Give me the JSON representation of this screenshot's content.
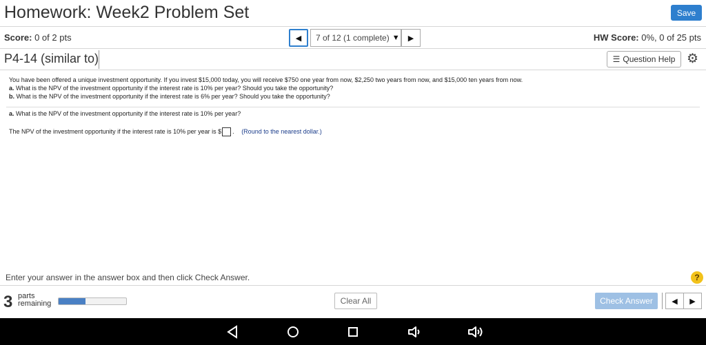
{
  "header": {
    "title": "Homework: Week2 Problem Set",
    "save_label": "Save"
  },
  "score_bar": {
    "score_label": "Score:",
    "score_value": "0 of 2 pts",
    "question_selector": "7 of 12 (1 complete)",
    "hw_score_label": "HW Score:",
    "hw_score_value": "0%, 0 of 25 pts"
  },
  "problem": {
    "id": "P4-14 (similar to)",
    "help_label": "Question Help"
  },
  "question": {
    "intro": "You have been offered a unique investment opportunity. If you invest $15,000 today, you will receive $750 one year from now, $2,250 two years from now, and $15,000 ten years from now.",
    "part_a_label": "a.",
    "part_a_text": "What is the NPV of the  investment opportunity if the interest rate is 10% per year?  Should you take the opportunity?",
    "part_b_label": "b.",
    "part_b_text": "What is the NPV of the  investment opportunity if the interest rate is 6% per year?  Should you take the opportunity?",
    "current_label": "a.",
    "current_text": "What is the NPV of the investment opportunity  if the interest rate is 10% per year?",
    "answer_prompt": "The NPV of the  investment opportunity  if the interest rate is 10% per year is $",
    "answer_suffix": ".",
    "answer_value": "",
    "hint": "(Round to the nearest dollar.)"
  },
  "footer": {
    "instruction": "Enter your answer in the answer box and then click Check Answer.",
    "help_symbol": "?",
    "parts_count": "3",
    "parts_label_1": "parts",
    "parts_label_2": "remaining",
    "progress_fraction": 0.4,
    "clear_all_label": "Clear All",
    "check_answer_label": "Check Answer"
  },
  "colors": {
    "accent": "#2e7fce",
    "check_disabled": "#9ec0e4",
    "help_badge": "#f2c21b"
  },
  "icons": [
    "prev-arrow-icon",
    "next-arrow-icon",
    "dropdown-caret-icon",
    "list-icon",
    "gear-icon",
    "help-icon",
    "nav-back-icon",
    "nav-home-icon",
    "nav-recents-icon",
    "volume-down-icon",
    "volume-up-icon"
  ]
}
